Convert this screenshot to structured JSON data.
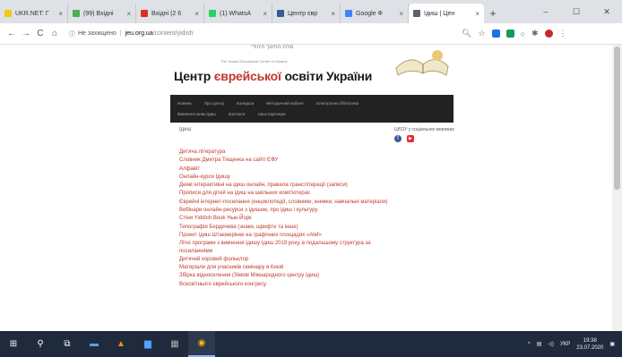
{
  "browser": {
    "tabs": [
      {
        "label": "UKR.NET: Г",
        "fav": "#f5c518",
        "active": false
      },
      {
        "label": "(99) Вхідні",
        "fav": "#4caf50",
        "active": false
      },
      {
        "label": "Вхідні (2 6",
        "fav": "#d93025",
        "active": false
      },
      {
        "label": "(1) WhatsA",
        "fav": "#25d366",
        "active": false
      },
      {
        "label": "Центр євр",
        "fav": "#3b5998",
        "active": false
      },
      {
        "label": "Google Ф",
        "fav": "#4285f4",
        "active": false
      },
      {
        "label": "Ідиш | Цен",
        "fav": "#5f6368",
        "active": true
      }
    ],
    "new_tab": "+",
    "window": {
      "minimize": "–",
      "maximize": "☐",
      "close": "✕"
    },
    "nav": {
      "back": "←",
      "forward": "→",
      "reload": "C",
      "home": "⌂"
    },
    "address": {
      "security": "Не захищено",
      "host": "jeu.org.ua",
      "path": "/content/yidish"
    }
  },
  "site": {
    "hebrew_header": "מרכז החינוך היהודי",
    "small_caption": "The Jewish Educational Center of Ukraine",
    "title_part1": "Центр ",
    "title_accent": "єврейської",
    "title_part2": " освіти України",
    "menu_row1": [
      "Новини",
      "Про Центр",
      "Конкурси",
      "Методичний кабінет",
      "Електронна бібліотека"
    ],
    "menu_row2": [
      "Вивчення мови ідиш",
      "Контакти",
      "Наші партнери"
    ],
    "breadcrumb": "Ідиш",
    "sidebar_title": "ЦЄОУ у соціальних мережах",
    "links": [
      "Дитяча література",
      "Словник Дмитра Тищенка на сайті ЄФУ",
      "Алфавіт",
      "Онлайн-курси Ідишу",
      "Деякі інтерактивні на ідиш онлайн, правила транслітерації (записи)",
      "Прописи для дітей на ідиш на шкільних комп'ютерах",
      "Єврейні інтернет-посилання (енциклопедії, словники, книжки, навчальні матеріали)",
      "Вебінари онлайн-ресурси з ідишем, про ідиш і культуру",
      "Стіни Yiddish Book Нью-Йорк",
      "Типографія Бердичева (знаки, шрифти та інше)",
      "Проект Ідиш Штаємерінке на графічних площадях «Alef»",
      "Літні програми з вивчення ідишу Ідиш 2019 року, в подальшому структура за посиланнями",
      "Дитячий хоровий фольклор",
      "Матеріали для учасників семінару в Києві",
      "Збірка відносилення (Зімові Міжнародного центру Ідиш)",
      "Всесвітнього єврейського конгресу"
    ]
  },
  "taskbar": {
    "lang": "УКР",
    "time": "19:38",
    "date": "23.07.2020"
  }
}
